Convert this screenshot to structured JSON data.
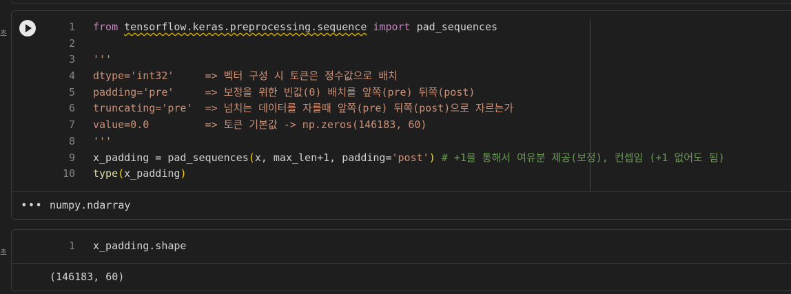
{
  "side_labels": [
    "초",
    "초"
  ],
  "cell1": {
    "lines": [
      {
        "n": "1",
        "tokens": [
          {
            "c": "kw",
            "t": "from"
          },
          {
            "c": "",
            "t": " "
          },
          {
            "c": "wavy",
            "t": "tensorflow.keras.preprocessing.sequence"
          },
          {
            "c": "",
            "t": " "
          },
          {
            "c": "kw",
            "t": "import"
          },
          {
            "c": "",
            "t": " pad_sequences"
          }
        ]
      },
      {
        "n": "2",
        "tokens": []
      },
      {
        "n": "3",
        "tokens": [
          {
            "c": "st",
            "t": "'''"
          }
        ]
      },
      {
        "n": "4",
        "tokens": [
          {
            "c": "st",
            "t": "dtype='int32'     => 벡터 구성 시 토큰은 정수값으로 배치"
          }
        ]
      },
      {
        "n": "5",
        "tokens": [
          {
            "c": "st",
            "t": "padding='pre'     => 보정을 위한 빈값(0) 배치를 앞쪽(pre) 뒤쪽(post)"
          }
        ]
      },
      {
        "n": "6",
        "tokens": [
          {
            "c": "st",
            "t": "truncating='pre'  => 넘치는 데이터를 자를때 앞쪽(pre) 뒤쪽(post)으로 자르는가"
          }
        ]
      },
      {
        "n": "7",
        "tokens": [
          {
            "c": "st",
            "t": "value=0.0         => 토큰 기본값 -> np.zeros(146183, 60)"
          }
        ]
      },
      {
        "n": "8",
        "tokens": [
          {
            "c": "st",
            "t": "'''"
          }
        ]
      },
      {
        "n": "9",
        "tokens": [
          {
            "c": "",
            "t": "x_padding = pad_sequences"
          },
          {
            "c": "bk",
            "t": "("
          },
          {
            "c": "",
            "t": "x, max_len+1, padding="
          },
          {
            "c": "st",
            "t": "'post'"
          },
          {
            "c": "bk",
            "t": ")"
          },
          {
            "c": "",
            "t": " "
          },
          {
            "c": "cm",
            "t": "# +1을 통해서 여유분 제공(보정), 컨셉임 (+1 없어도 됨)"
          }
        ]
      },
      {
        "n": "10",
        "tokens": [
          {
            "c": "fn",
            "t": "type"
          },
          {
            "c": "bk",
            "t": "("
          },
          {
            "c": "",
            "t": "x_padding"
          },
          {
            "c": "bk",
            "t": ")"
          }
        ]
      }
    ],
    "output_icon": "•••",
    "output": "numpy.ndarray"
  },
  "cell2": {
    "lines": [
      {
        "n": "1",
        "tokens": [
          {
            "c": "",
            "t": "x_padding.shape"
          }
        ]
      }
    ],
    "output": "(146183, 60)"
  },
  "icons": {
    "run": "play-circle-icon",
    "more": "more-horizontal-icon"
  }
}
